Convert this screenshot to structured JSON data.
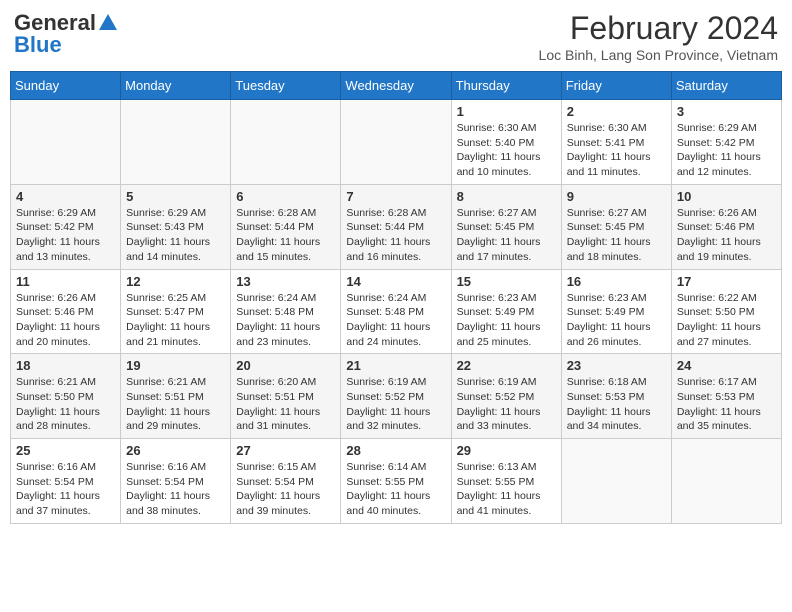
{
  "header": {
    "logo_general": "General",
    "logo_blue": "Blue",
    "month_year": "February 2024",
    "location": "Loc Binh, Lang Son Province, Vietnam"
  },
  "days_of_week": [
    "Sunday",
    "Monday",
    "Tuesday",
    "Wednesday",
    "Thursday",
    "Friday",
    "Saturday"
  ],
  "weeks": [
    [
      {
        "day": "",
        "sunrise": "",
        "sunset": "",
        "daylight": "",
        "empty": true
      },
      {
        "day": "",
        "sunrise": "",
        "sunset": "",
        "daylight": "",
        "empty": true
      },
      {
        "day": "",
        "sunrise": "",
        "sunset": "",
        "daylight": "",
        "empty": true
      },
      {
        "day": "",
        "sunrise": "",
        "sunset": "",
        "daylight": "",
        "empty": true
      },
      {
        "day": "1",
        "sunrise": "Sunrise: 6:30 AM",
        "sunset": "Sunset: 5:40 PM",
        "daylight": "Daylight: 11 hours and 10 minutes.",
        "empty": false
      },
      {
        "day": "2",
        "sunrise": "Sunrise: 6:30 AM",
        "sunset": "Sunset: 5:41 PM",
        "daylight": "Daylight: 11 hours and 11 minutes.",
        "empty": false
      },
      {
        "day": "3",
        "sunrise": "Sunrise: 6:29 AM",
        "sunset": "Sunset: 5:42 PM",
        "daylight": "Daylight: 11 hours and 12 minutes.",
        "empty": false
      }
    ],
    [
      {
        "day": "4",
        "sunrise": "Sunrise: 6:29 AM",
        "sunset": "Sunset: 5:42 PM",
        "daylight": "Daylight: 11 hours and 13 minutes.",
        "empty": false
      },
      {
        "day": "5",
        "sunrise": "Sunrise: 6:29 AM",
        "sunset": "Sunset: 5:43 PM",
        "daylight": "Daylight: 11 hours and 14 minutes.",
        "empty": false
      },
      {
        "day": "6",
        "sunrise": "Sunrise: 6:28 AM",
        "sunset": "Sunset: 5:44 PM",
        "daylight": "Daylight: 11 hours and 15 minutes.",
        "empty": false
      },
      {
        "day": "7",
        "sunrise": "Sunrise: 6:28 AM",
        "sunset": "Sunset: 5:44 PM",
        "daylight": "Daylight: 11 hours and 16 minutes.",
        "empty": false
      },
      {
        "day": "8",
        "sunrise": "Sunrise: 6:27 AM",
        "sunset": "Sunset: 5:45 PM",
        "daylight": "Daylight: 11 hours and 17 minutes.",
        "empty": false
      },
      {
        "day": "9",
        "sunrise": "Sunrise: 6:27 AM",
        "sunset": "Sunset: 5:45 PM",
        "daylight": "Daylight: 11 hours and 18 minutes.",
        "empty": false
      },
      {
        "day": "10",
        "sunrise": "Sunrise: 6:26 AM",
        "sunset": "Sunset: 5:46 PM",
        "daylight": "Daylight: 11 hours and 19 minutes.",
        "empty": false
      }
    ],
    [
      {
        "day": "11",
        "sunrise": "Sunrise: 6:26 AM",
        "sunset": "Sunset: 5:46 PM",
        "daylight": "Daylight: 11 hours and 20 minutes.",
        "empty": false
      },
      {
        "day": "12",
        "sunrise": "Sunrise: 6:25 AM",
        "sunset": "Sunset: 5:47 PM",
        "daylight": "Daylight: 11 hours and 21 minutes.",
        "empty": false
      },
      {
        "day": "13",
        "sunrise": "Sunrise: 6:24 AM",
        "sunset": "Sunset: 5:48 PM",
        "daylight": "Daylight: 11 hours and 23 minutes.",
        "empty": false
      },
      {
        "day": "14",
        "sunrise": "Sunrise: 6:24 AM",
        "sunset": "Sunset: 5:48 PM",
        "daylight": "Daylight: 11 hours and 24 minutes.",
        "empty": false
      },
      {
        "day": "15",
        "sunrise": "Sunrise: 6:23 AM",
        "sunset": "Sunset: 5:49 PM",
        "daylight": "Daylight: 11 hours and 25 minutes.",
        "empty": false
      },
      {
        "day": "16",
        "sunrise": "Sunrise: 6:23 AM",
        "sunset": "Sunset: 5:49 PM",
        "daylight": "Daylight: 11 hours and 26 minutes.",
        "empty": false
      },
      {
        "day": "17",
        "sunrise": "Sunrise: 6:22 AM",
        "sunset": "Sunset: 5:50 PM",
        "daylight": "Daylight: 11 hours and 27 minutes.",
        "empty": false
      }
    ],
    [
      {
        "day": "18",
        "sunrise": "Sunrise: 6:21 AM",
        "sunset": "Sunset: 5:50 PM",
        "daylight": "Daylight: 11 hours and 28 minutes.",
        "empty": false
      },
      {
        "day": "19",
        "sunrise": "Sunrise: 6:21 AM",
        "sunset": "Sunset: 5:51 PM",
        "daylight": "Daylight: 11 hours and 29 minutes.",
        "empty": false
      },
      {
        "day": "20",
        "sunrise": "Sunrise: 6:20 AM",
        "sunset": "Sunset: 5:51 PM",
        "daylight": "Daylight: 11 hours and 31 minutes.",
        "empty": false
      },
      {
        "day": "21",
        "sunrise": "Sunrise: 6:19 AM",
        "sunset": "Sunset: 5:52 PM",
        "daylight": "Daylight: 11 hours and 32 minutes.",
        "empty": false
      },
      {
        "day": "22",
        "sunrise": "Sunrise: 6:19 AM",
        "sunset": "Sunset: 5:52 PM",
        "daylight": "Daylight: 11 hours and 33 minutes.",
        "empty": false
      },
      {
        "day": "23",
        "sunrise": "Sunrise: 6:18 AM",
        "sunset": "Sunset: 5:53 PM",
        "daylight": "Daylight: 11 hours and 34 minutes.",
        "empty": false
      },
      {
        "day": "24",
        "sunrise": "Sunrise: 6:17 AM",
        "sunset": "Sunset: 5:53 PM",
        "daylight": "Daylight: 11 hours and 35 minutes.",
        "empty": false
      }
    ],
    [
      {
        "day": "25",
        "sunrise": "Sunrise: 6:16 AM",
        "sunset": "Sunset: 5:54 PM",
        "daylight": "Daylight: 11 hours and 37 minutes.",
        "empty": false
      },
      {
        "day": "26",
        "sunrise": "Sunrise: 6:16 AM",
        "sunset": "Sunset: 5:54 PM",
        "daylight": "Daylight: 11 hours and 38 minutes.",
        "empty": false
      },
      {
        "day": "27",
        "sunrise": "Sunrise: 6:15 AM",
        "sunset": "Sunset: 5:54 PM",
        "daylight": "Daylight: 11 hours and 39 minutes.",
        "empty": false
      },
      {
        "day": "28",
        "sunrise": "Sunrise: 6:14 AM",
        "sunset": "Sunset: 5:55 PM",
        "daylight": "Daylight: 11 hours and 40 minutes.",
        "empty": false
      },
      {
        "day": "29",
        "sunrise": "Sunrise: 6:13 AM",
        "sunset": "Sunset: 5:55 PM",
        "daylight": "Daylight: 11 hours and 41 minutes.",
        "empty": false
      },
      {
        "day": "",
        "sunrise": "",
        "sunset": "",
        "daylight": "",
        "empty": true
      },
      {
        "day": "",
        "sunrise": "",
        "sunset": "",
        "daylight": "",
        "empty": true
      }
    ]
  ]
}
